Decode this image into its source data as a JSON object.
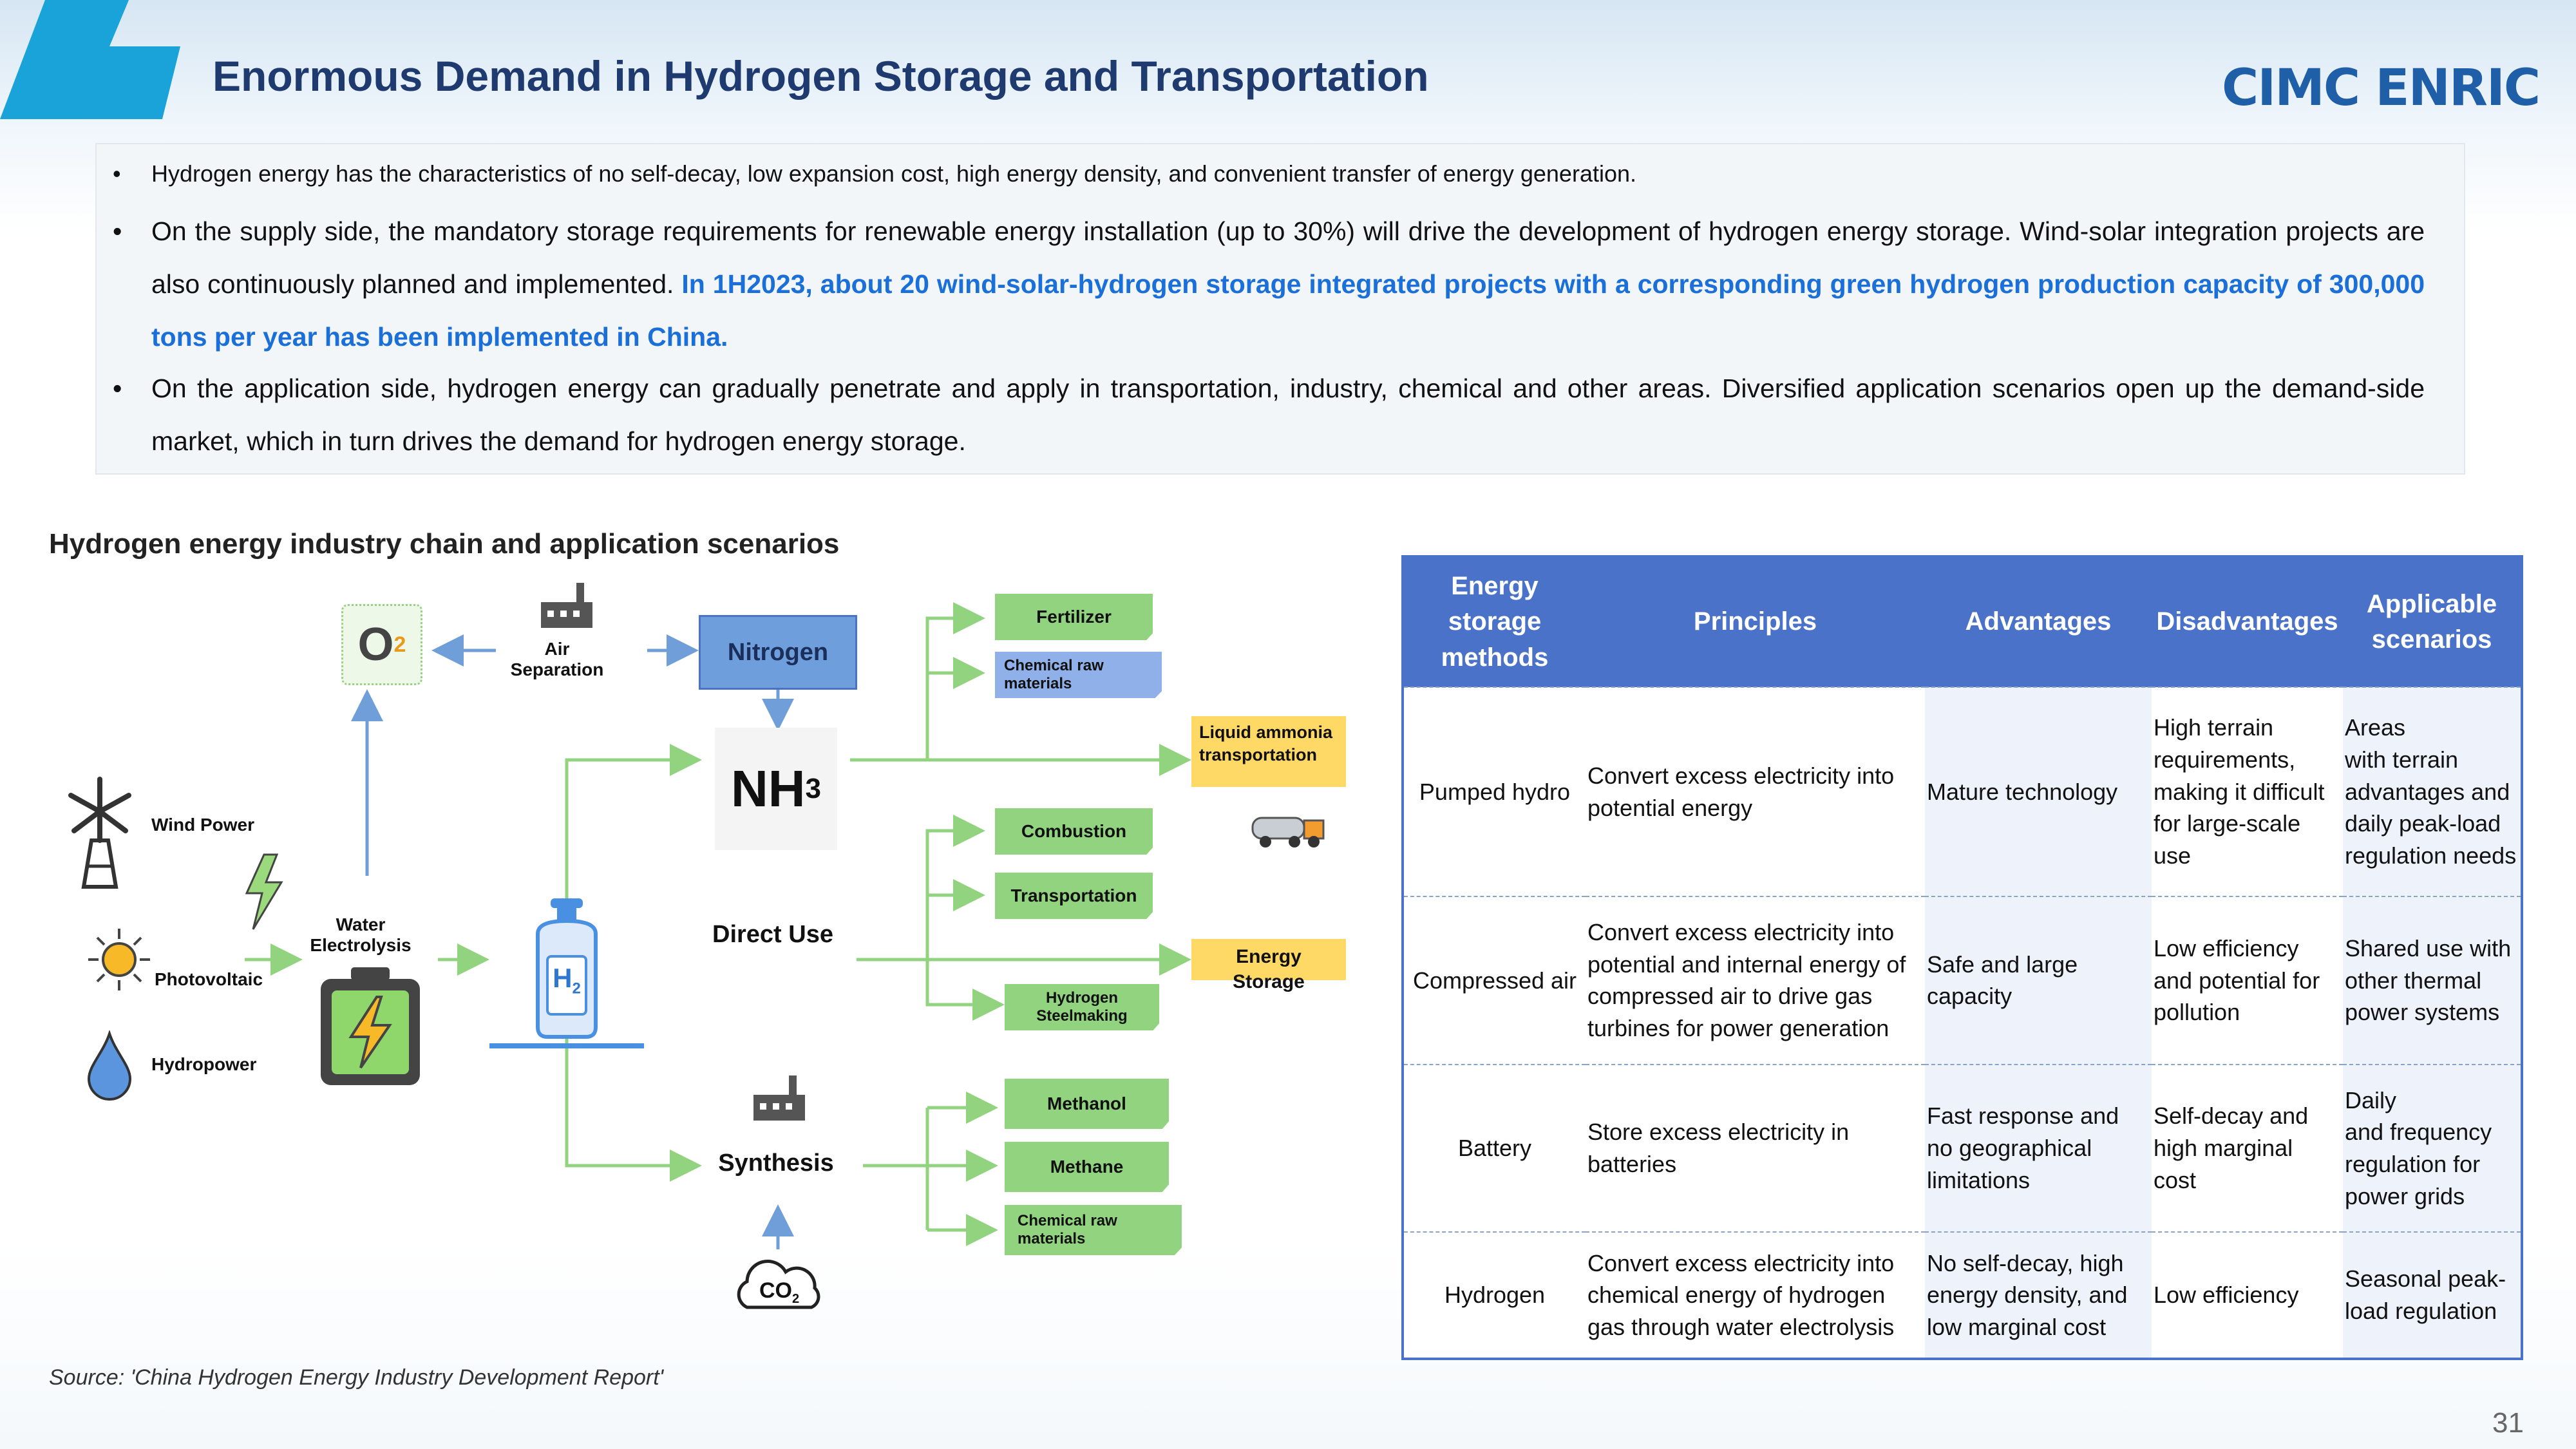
{
  "header": {
    "title": "Enormous Demand in Hydrogen Storage and Transportation",
    "logo": "CIMC ENRIC",
    "accent_color": "#1aa3d8"
  },
  "bullets": [
    {
      "text": "Hydrogen energy has the characteristics of no self-decay, low expansion cost, high energy density, and convenient transfer of energy generation."
    },
    {
      "text": "On the supply side, the mandatory storage requirements for renewable energy installation (up to 30%) will drive the development of hydrogen energy storage. Wind-solar integration projects are also continuously planned and implemented. ",
      "highlight": "In 1H2023, about 20 wind-solar-hydrogen storage integrated projects with a corresponding green hydrogen production capacity of 300,000 tons per year has been implemented in China.",
      "highlight_color": "#1a6fd8"
    },
    {
      "text": "On the application side, hydrogen energy can gradually penetrate and apply in transportation, industry, chemical and other areas. Diversified application scenarios open up the demand-side market, which in turn drives the demand for hydrogen energy storage."
    }
  ],
  "section_title": "Hydrogen energy industry chain and application scenarios",
  "diagram": {
    "o2": "O",
    "o2_sub": "2",
    "air_separation": "Air\nSeparation",
    "nitrogen": "Nitrogen",
    "nh3": "NH",
    "nh3_sub": "3",
    "wind": "Wind Power",
    "pv": "Photovoltaic",
    "hydro": "Hydropower",
    "electrolysis": "Water\nElectrolysis",
    "h2": "H",
    "h2_sub": "2",
    "direct_use": "Direct Use",
    "synthesis": "Synthesis",
    "co2": "CO",
    "co2_sub": "2",
    "nh3_outputs": [
      "Fertilizer",
      "Chemical raw\nmaterials"
    ],
    "liquid_ammonia": "Liquid ammonia\ntransportation",
    "direct_outputs": [
      "Combustion",
      "Transportation",
      "Hydrogen\nSteelmaking"
    ],
    "energy_storage": "Energy Storage",
    "synthesis_outputs": [
      "Methanol",
      "Methane",
      "Chemical raw\nmaterials"
    ],
    "green_color": "#92d37f",
    "yellow_color": "#ffd966",
    "blue_color": "#4a7fd6"
  },
  "table": {
    "headers": [
      "Energy storage methods",
      "Principles",
      "Advantages",
      "Disadvantages",
      "Applicable scenarios"
    ],
    "rows": [
      [
        "Pumped hydro",
        "Convert excess electricity into potential energy",
        "Mature technology",
        "High terrain requirements, making it difficult for large-scale use",
        "Areas\nwith terrain advantages and daily peak-load regulation needs"
      ],
      [
        "Compressed air",
        "Convert excess electricity into potential and internal energy of compressed air to drive gas turbines for power generation",
        "Safe and large capacity",
        "Low efficiency and potential for pollution",
        "Shared use with other thermal power systems"
      ],
      [
        "Battery",
        "Store excess electricity in batteries",
        "Fast response and no geographical limitations",
        "Self-decay and high marginal cost",
        "Daily\nand frequency regulation for power grids"
      ],
      [
        "Hydrogen",
        "Convert excess electricity into chemical energy of hydrogen gas through water electrolysis",
        "No self-decay, high energy density, and low marginal cost",
        "Low efficiency",
        "Seasonal peak-load regulation"
      ]
    ],
    "header_color": "#4a72c9"
  },
  "source": "Source: 'China Hydrogen Energy Industry Development Report'",
  "page_number": "31"
}
